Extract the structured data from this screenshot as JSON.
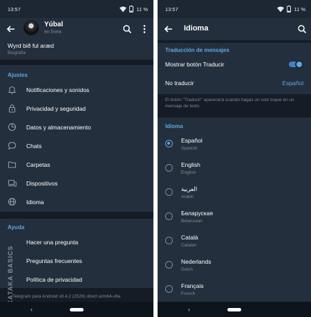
{
  "left": {
    "status": {
      "time": "13:57",
      "battery": "11 %"
    },
    "profile": {
      "name": "Yúbal",
      "status": "en línea"
    },
    "bio": {
      "text": "Wyrd bið ful aræd",
      "label": "Biografía"
    },
    "settings_header": "Ajustes",
    "settings_items": [
      {
        "label": "Notificaciones y sonidos",
        "icon": "bell-icon"
      },
      {
        "label": "Privacidad y seguridad",
        "icon": "lock-icon"
      },
      {
        "label": "Datos y almacenamiento",
        "icon": "pie-chart-icon"
      },
      {
        "label": "Chats",
        "icon": "chat-bubble-icon"
      },
      {
        "label": "Carpetas",
        "icon": "folder-icon"
      },
      {
        "label": "Dispositivos",
        "icon": "devices-icon"
      },
      {
        "label": "Idioma",
        "icon": "globe-icon"
      }
    ],
    "help_header": "Ayuda",
    "help_items": [
      {
        "label": "Hacer una pregunta"
      },
      {
        "label": "Preguntas frecuentes"
      },
      {
        "label": "Política de privacidad"
      }
    ],
    "footer": "Telegram para Android v8.4.2 (2526) direct arm64-v8a",
    "watermark": "XATAKA BASICS"
  },
  "right": {
    "status": {
      "time": "13:57",
      "battery": "11 %"
    },
    "title": "Idioma",
    "translation_header": "Traducción de mensajes",
    "show_translate": {
      "label": "Mostrar botón Traducir",
      "enabled": true
    },
    "do_not_translate": {
      "label": "No traducir",
      "value": "Español"
    },
    "hint": "El botón \"Traducir\" aparecerá cuando hagas un solo toque en un mensaje de texto.",
    "language_header": "Idioma",
    "languages": [
      {
        "name": "Español",
        "native": "Spanish",
        "selected": true
      },
      {
        "name": "English",
        "native": "English",
        "selected": false
      },
      {
        "name": "العربية",
        "native": "Arabic",
        "selected": false
      },
      {
        "name": "Беларуская",
        "native": "Belarusian",
        "selected": false
      },
      {
        "name": "Català",
        "native": "Catalan",
        "selected": false
      },
      {
        "name": "Nederlands",
        "native": "Dutch",
        "selected": false
      },
      {
        "name": "Français",
        "native": "French",
        "selected": false
      }
    ]
  },
  "colors": {
    "background": "#1d2733",
    "surface": "#242f3d",
    "accent": "#5ea8e2",
    "secondary_text": "#7c8b9a"
  }
}
